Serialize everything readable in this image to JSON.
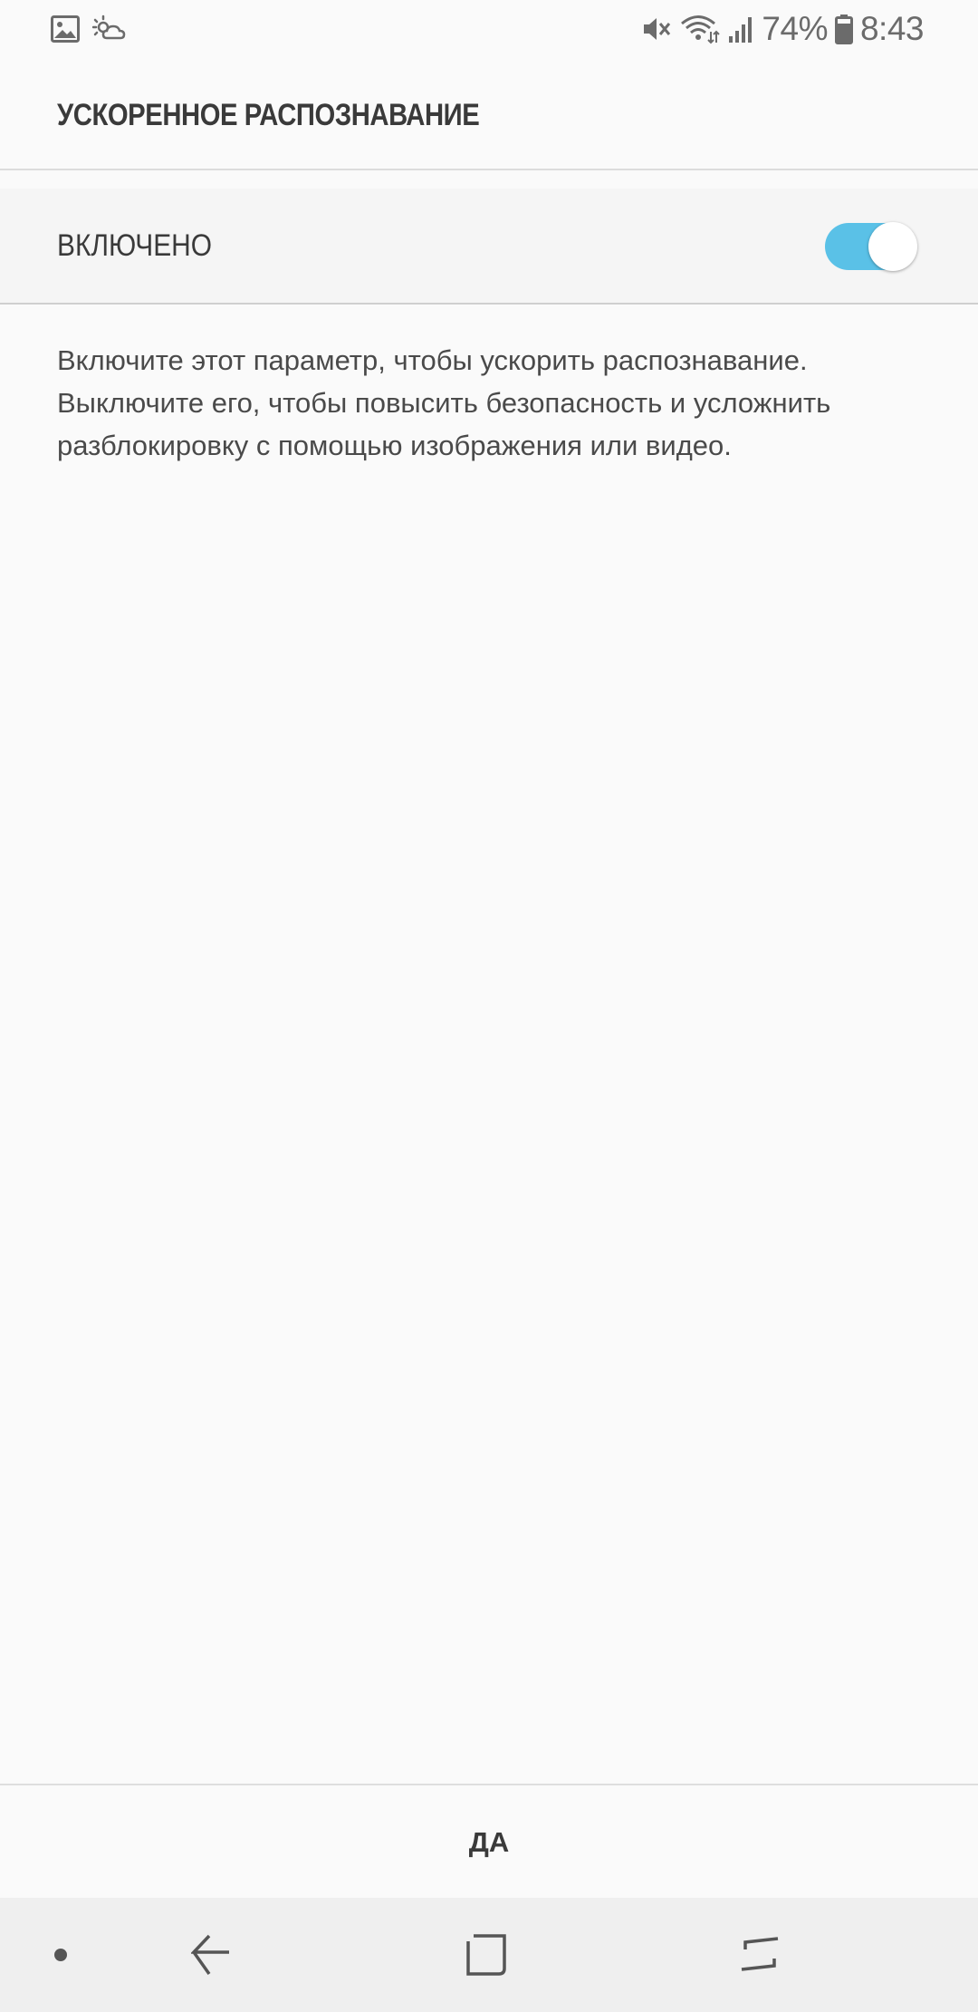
{
  "status_bar": {
    "battery_percent": "74%",
    "time": "8:43",
    "left_icons": [
      "gallery-icon",
      "weather-icon"
    ],
    "right_icons": [
      "mute-icon",
      "wifi-icon",
      "signal-icon",
      "battery-icon"
    ]
  },
  "header": {
    "title": "УСКОРЕННОЕ РАСПОЗНАВАНИЕ"
  },
  "setting": {
    "label": "ВКЛЮЧЕНО",
    "enabled": true,
    "accent_color": "#5ac1e7"
  },
  "description": "Включите этот параметр, чтобы ускорить распознавание. Выключите его, чтобы повысить безопасность и усложнить разблокировку с помощью изображения или видео.",
  "footer": {
    "ok_label": "ДА"
  },
  "nav_bar": {
    "items": [
      "dot-icon",
      "back-icon",
      "home-icon",
      "recents-icon"
    ]
  }
}
